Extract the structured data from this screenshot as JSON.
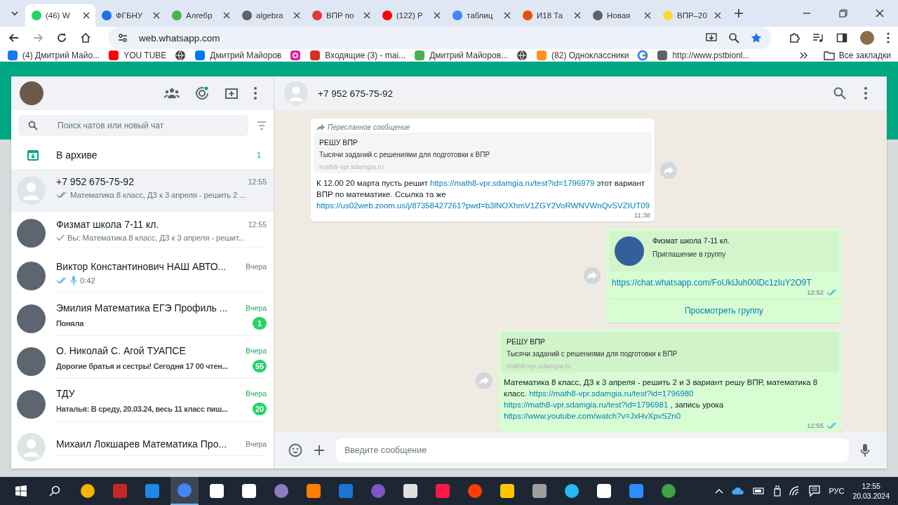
{
  "browser": {
    "tabs": [
      {
        "label": "(46) W",
        "selected": true
      },
      {
        "label": "ФГБНУ",
        "selected": false
      },
      {
        "label": "Алгебр",
        "selected": false
      },
      {
        "label": "algebra",
        "selected": false
      },
      {
        "label": "ВПР по",
        "selected": false
      },
      {
        "label": "(122) P",
        "selected": false
      },
      {
        "label": "таблиц",
        "selected": false
      },
      {
        "label": "И18 Та",
        "selected": false
      },
      {
        "label": "Новая",
        "selected": false
      },
      {
        "label": "ВПР–20",
        "selected": false
      }
    ],
    "address": "web.whatsapp.com",
    "bookmarks": [
      {
        "label": "(4) Дмитрий Майо..."
      },
      {
        "label": "YOU TUBE"
      },
      {
        "label": "Дмитрий Майоров"
      },
      {
        "label": "Входящие (3) - mai..."
      },
      {
        "label": "Дмитрий Майоров..."
      },
      {
        "label": "(82) Одноклассники"
      },
      {
        "label": "http://www.pstbionl..."
      }
    ],
    "all_bookmarks": "Все закладки"
  },
  "sidebar": {
    "search": {
      "placeholder": "Поиск чатов или новый чат"
    },
    "archive": {
      "label": "В архиве",
      "count": "1"
    },
    "chats": [
      {
        "name": "+7 952 675-75-92",
        "time": "12:55",
        "preview": "Математика 8 класс, ДЗ к 3 апреля - решить 2 ...",
        "kind": "delivered",
        "voice": false,
        "has_photo": false,
        "selected": true
      },
      {
        "name": "Физмат школа 7-11 кл.",
        "time": "12:55",
        "preview": "Вы: Математика 8 класс, ДЗ к 3 апреля - решит...",
        "kind": "sent",
        "voice": false,
        "has_photo": true,
        "selected": false
      },
      {
        "name": "Виктор Константинович НАШ АВТО...",
        "time": "Вчера",
        "preview": "0:42",
        "kind": "read",
        "voice": true,
        "has_photo": true,
        "selected": false
      },
      {
        "name": "Эмилия Математика ЕГЭ Профиль ...",
        "time": "Вчера",
        "preview": "Поняла",
        "kind": "incoming",
        "voice": false,
        "unread": "1",
        "has_photo": true,
        "selected": false
      },
      {
        "name": "О. Николай С. Агой ТУАПСЕ",
        "time": "Вчера",
        "preview": "Дорогие братья и сестры! Сегодня 17 00 чтен...",
        "kind": "incoming",
        "voice": false,
        "unread": "55",
        "has_photo": true,
        "selected": false
      },
      {
        "name": "ТДУ",
        "time": "Вчера",
        "preview": "Наталья: В среду, 20.03.24, весь 11 класс пиш...",
        "kind": "incoming",
        "voice": false,
        "unread": "20",
        "has_photo": true,
        "selected": false
      },
      {
        "name": "Михаил Локшарев Математика Про...",
        "time": "Вчера",
        "voice": false,
        "has_photo": false,
        "selected": false
      }
    ]
  },
  "chat": {
    "title": "+7 952 675-75-92",
    "messages": [
      {
        "kind": "link-preview",
        "outgoing": false,
        "forwarded": "Пересланное сообщение",
        "preview": {
          "title": "РЕШУ ВПР",
          "description": "Тысячи заданий с решениями для подготовки к ВПР",
          "domain": "math8-vpr.sdamgia.ru"
        },
        "text": [
          {
            "text": "К 12.00 20 марта пусть решит",
            "link": false
          },
          {
            "text": "https://math8-vpr.sdamgia.ru/test?id=1796979",
            "link": true
          },
          {
            "text": "этот вариант ВПР по математике. Ссылка та же",
            "link": false
          },
          {
            "text": "https://us02web.zoom.us/j/87358427261?pwd=b3lNOXhmV1ZGY2VoRWNVWnQvSVZIUT09",
            "link": true
          }
        ],
        "time": "11:38",
        "read": false
      },
      {
        "kind": "group-invite",
        "outgoing": true,
        "group": "Физмат школа 7-11 кл.",
        "subtitle": "Приглашение в группу",
        "link": "https://chat.whatsapp.com/FoUklJuh00lDc1zIuY2O9T",
        "button": "Просмотреть группу",
        "time": "12:52",
        "read": true
      },
      {
        "kind": "link-preview",
        "outgoing": true,
        "preview": {
          "title": "РЕШУ ВПР",
          "description": "Тысячи заданий с решениями для подготовки к ВПР",
          "domain": "math8-vpr.sdamgia.ru"
        },
        "text": [
          {
            "text": "Математика 8 класс, ДЗ к 3 апреля - решить 2 и 3 вариант решу ВПР, математика 8 класс.",
            "link": false
          },
          {
            "text": "https://math8-vpr.sdamgia.ru/test?id=1796980",
            "link": true
          },
          {
            "text": "https://math8-vpr.sdamgia.ru/test?id=1796981",
            "link": true
          },
          {
            "text": ", запись урока",
            "link": false
          },
          {
            "text": "https://www.youtube.com/watch?v=JxHvXpvS2n0",
            "link": true
          }
        ],
        "time": "12:55",
        "read": true
      }
    ],
    "composer": {
      "placeholder": "Введите сообщение"
    }
  },
  "taskbar": {
    "language": "РУС",
    "time": "12:55",
    "date": "20.03.2024"
  }
}
